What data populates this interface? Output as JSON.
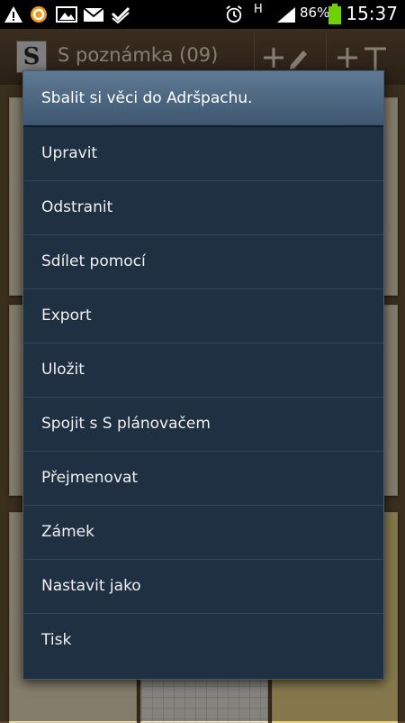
{
  "status_bar": {
    "network": "H",
    "battery": "86%",
    "time": "15:37",
    "icons": [
      "warning-icon",
      "app-notification-icon",
      "image-icon",
      "gmail-icon",
      "clipboard-check-icon",
      "alarm-icon",
      "signal-icon",
      "battery-icon"
    ]
  },
  "app_bar": {
    "logo_letter": "S",
    "title": "S poznámka (09)",
    "icons": [
      "add-pen-note-icon",
      "add-text-note-icon"
    ]
  },
  "dialog": {
    "title": "Sbalit si věci do Adršpachu.",
    "items": [
      {
        "label": "Upravit"
      },
      {
        "label": "Odstranit"
      },
      {
        "label": "Sdílet pomocí"
      },
      {
        "label": "Export"
      },
      {
        "label": "Uložit"
      },
      {
        "label": "Spojit s S plánovačem"
      },
      {
        "label": "Přejmenovat"
      },
      {
        "label": "Zámek"
      },
      {
        "label": "Nastavit jako"
      },
      {
        "label": "Tisk"
      }
    ]
  },
  "colors": {
    "dialog_bg": "#1f3042",
    "title_bg": "#4f6a85",
    "battery_green": "#6fd100"
  }
}
